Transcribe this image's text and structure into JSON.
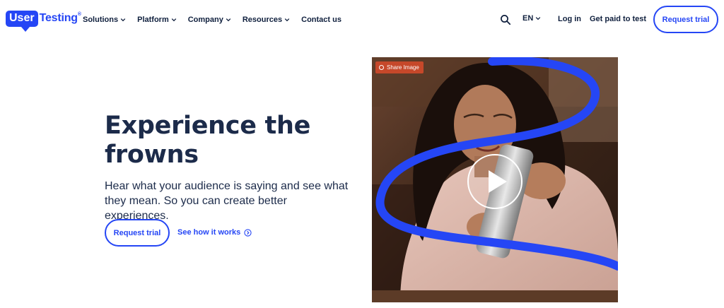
{
  "brand": {
    "logo_user": "User",
    "logo_testing": "Testing",
    "logo_reg": "®",
    "accent": "#2546f5",
    "text_dark": "#1c2b4a"
  },
  "nav": {
    "items": [
      {
        "label": "Solutions",
        "has_dropdown": true
      },
      {
        "label": "Platform",
        "has_dropdown": true
      },
      {
        "label": "Company",
        "has_dropdown": true
      },
      {
        "label": "Resources",
        "has_dropdown": true
      },
      {
        "label": "Contact us",
        "has_dropdown": false
      }
    ],
    "search_icon": "search-icon",
    "language": "EN",
    "login": "Log in",
    "get_paid": "Get paid to test",
    "cta": "Request trial"
  },
  "hero": {
    "title": "Experience the frowns",
    "subtitle": "Hear what your audience is saying and see what they mean. So you can create better experiences.",
    "cta": "Request trial",
    "secondary_link": "See how it works",
    "secondary_icon": "circle-arrow-right-icon"
  },
  "media": {
    "share_label": "Share Image",
    "share_color": "#c6482a",
    "play_icon": "play-icon"
  }
}
